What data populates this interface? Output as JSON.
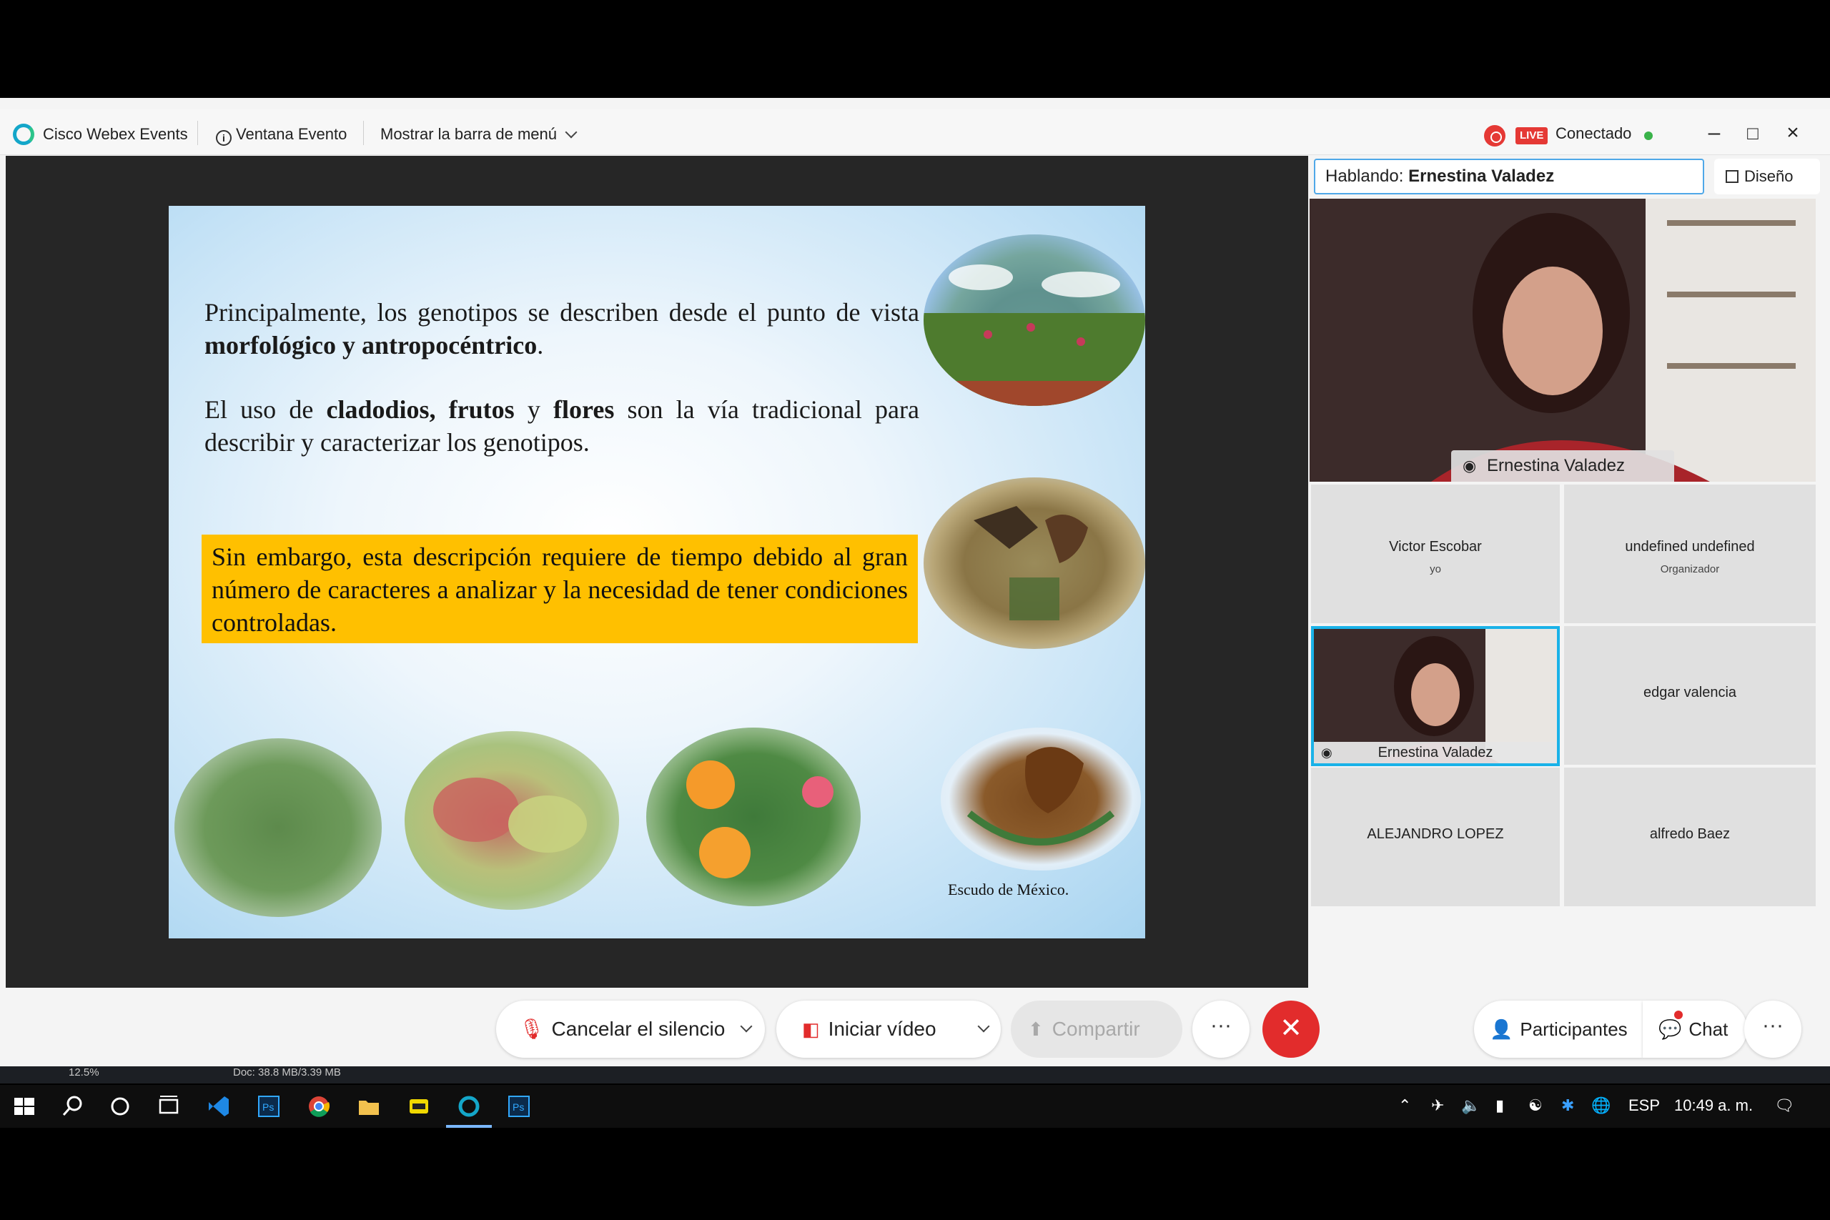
{
  "titlebar": {
    "app_name": "Cisco Webex Events",
    "event_window": "Ventana Evento",
    "menu_bar": "Mostrar la barra de menú",
    "live": "LIVE",
    "connection": "Conectado"
  },
  "slide": {
    "p1_a": "Principalmente, los genotipos se describen desde el punto de vista ",
    "p1_b": "morfológico y antropocéntrico",
    "p1_c": ".",
    "p2_a": "El uso de ",
    "p2_b": "cladodios, frutos",
    "p2_c": " y ",
    "p2_d": "flores",
    "p2_e": " son la vía tradicional para describir y caracterizar los genotipos.",
    "highlight": "Sin embargo, esta descripción requiere de tiempo debido al gran número de caracteres a analizar y la necesidad de tener condiciones controladas.",
    "caption": "Escudo de México."
  },
  "panel": {
    "speaking_label": "Hablando:",
    "speaking_name": "Ernestina Valadez",
    "layout_label": "Diseño",
    "main_video_name": "Ernestina Valadez",
    "participants": [
      {
        "name": "Victor Escobar",
        "role": "yo"
      },
      {
        "name": "undefined undefined",
        "role": "Organizador"
      },
      {
        "name": "Ernestina Valadez",
        "role": ""
      },
      {
        "name": "edgar valencia",
        "role": ""
      },
      {
        "name": "ALEJANDRO LOPEZ",
        "role": ""
      },
      {
        "name": "alfredo Baez",
        "role": ""
      }
    ]
  },
  "controls": {
    "unmute": "Cancelar el silencio",
    "start_video": "Iniciar vídeo",
    "share": "Compartir",
    "more": "···",
    "participants": "Participantes",
    "chat": "Chat"
  },
  "os_strip": {
    "zoom": "12.5%",
    "doc": "Doc: 38.8 MB/3.39 MB"
  },
  "taskbar": {
    "language": "ESP",
    "clock": "10:49 a. m."
  },
  "colors": {
    "accent": "#1ab2e8",
    "highlight": "#ffc000",
    "end": "#e22c2c",
    "live": "#e53935",
    "connected": "#3ab34a"
  }
}
